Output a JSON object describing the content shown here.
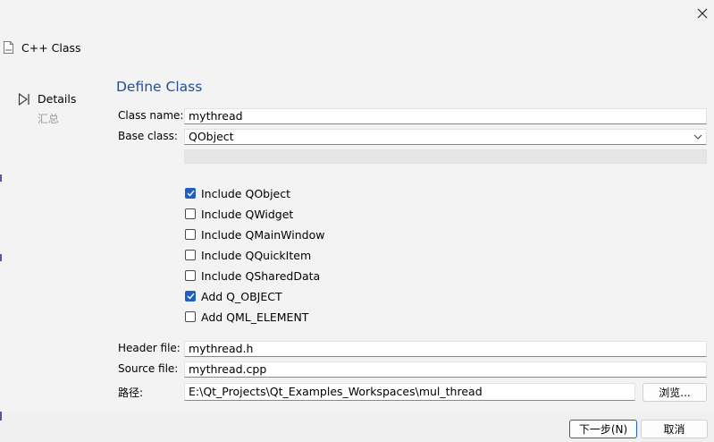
{
  "wizard": {
    "title": "C++ Class",
    "steps": [
      {
        "label": "Details",
        "active": true
      },
      {
        "label": "汇总",
        "active": false
      }
    ]
  },
  "page": {
    "title": "Define Class",
    "class_name": {
      "label": "Class name:",
      "value": "mythread"
    },
    "base_class": {
      "label": "Base class:",
      "value": "QObject"
    },
    "options": [
      {
        "label": "Include QObject",
        "checked": true
      },
      {
        "label": "Include QWidget",
        "checked": false
      },
      {
        "label": "Include QMainWindow",
        "checked": false
      },
      {
        "label": "Include QQuickItem",
        "checked": false
      },
      {
        "label": "Include QSharedData",
        "checked": false
      },
      {
        "label": "Add Q_OBJECT",
        "checked": true
      },
      {
        "label": "Add QML_ELEMENT",
        "checked": false
      }
    ],
    "header_file": {
      "label": "Header file:",
      "value": "mythread.h"
    },
    "source_file": {
      "label": "Source file:",
      "value": "mythread.cpp"
    },
    "path": {
      "label": "路径:",
      "value": "E:\\Qt_Projects\\Qt_Examples_Workspaces\\mul_thread",
      "browse_label": "浏览..."
    }
  },
  "footer": {
    "next_label": "下一步(N)",
    "cancel_label": "取消"
  },
  "colors": {
    "accent": "#1f5fbf",
    "title_blue": "#1f4f9c",
    "background": "#f3f3f3"
  }
}
